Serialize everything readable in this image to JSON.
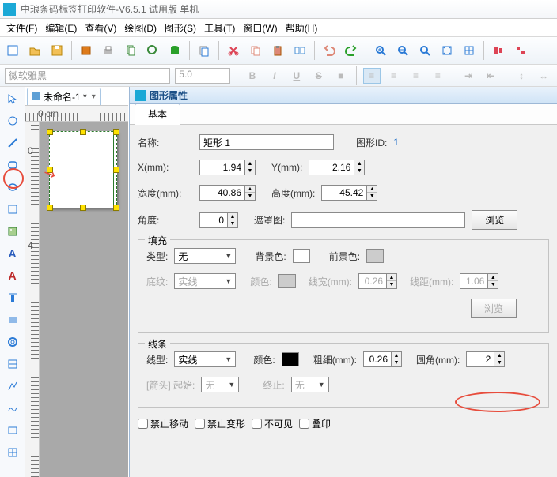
{
  "title": "中琅条码标签打印软件-V6.5.1 试用版 单机",
  "menu": {
    "file": "文件(F)",
    "edit": "编辑(E)",
    "view": "查看(V)",
    "draw": "绘图(D)",
    "shape": "图形(S)",
    "tool": "工具(T)",
    "window": "窗口(W)",
    "help": "帮助(H)"
  },
  "font": {
    "name": "微软雅黑",
    "size": "5.0"
  },
  "doc": {
    "tab": "未命名-1 *",
    "unit": "0 cm"
  },
  "prop": {
    "title": "图形属性",
    "tab": "基本",
    "name_lbl": "名称:",
    "name": "矩形 1",
    "id_lbl": "图形ID:",
    "id": "1",
    "x_lbl": "X(mm):",
    "x": "1.94",
    "y_lbl": "Y(mm):",
    "y": "2.16",
    "w_lbl": "宽度(mm):",
    "w": "40.86",
    "h_lbl": "高度(mm):",
    "h": "45.42",
    "ang_lbl": "角度:",
    "ang": "0",
    "mask_lbl": "遮罩图:",
    "browse": "浏览",
    "fill": {
      "legend": "填充",
      "type_lbl": "类型:",
      "type": "无",
      "bg_lbl": "背景色:",
      "fg_lbl": "前景色:",
      "pat_lbl": "底纹:",
      "pat": "实线",
      "color_lbl": "颜色:",
      "lw_lbl": "线宽(mm):",
      "lw": "0.26",
      "ld_lbl": "线距(mm):",
      "ld": "1.06",
      "browse": "浏览"
    },
    "line": {
      "legend": "线条",
      "type_lbl": "线型:",
      "type": "实线",
      "color_lbl": "颜色:",
      "thick_lbl": "粗细(mm):",
      "thick": "0.26",
      "round_lbl": "圆角(mm):",
      "round": "2",
      "arrow_lbl": "[箭头] 起始:",
      "arrow_s": "无",
      "end_lbl": "终止:",
      "end": "无"
    },
    "checks": {
      "lock": "禁止移动",
      "noresize": "禁止变形",
      "hidden": "不可见",
      "overprint": "叠印"
    }
  }
}
